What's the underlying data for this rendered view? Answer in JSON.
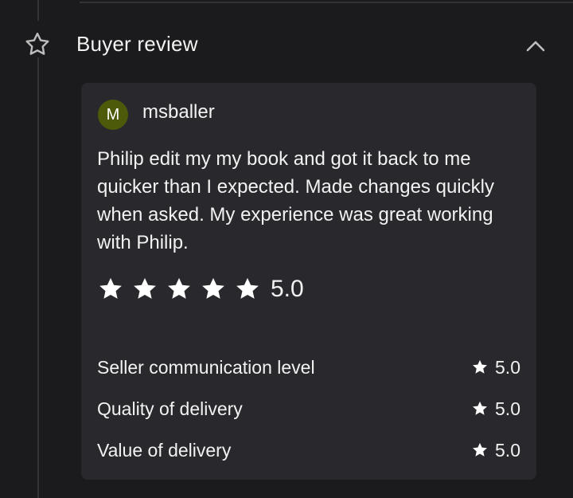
{
  "section": {
    "title": "Buyer review",
    "icon": "star-outline-icon",
    "collapse_icon": "chevron-up-icon"
  },
  "review": {
    "avatar_initial": "M",
    "avatar_color": "#4d5a09",
    "username": "msballer",
    "text": "Philip edit my my book and got it back to me quicker than I expected. Made changes quickly when asked. My experience was great working with Philip.",
    "rating": {
      "stars": 5,
      "score": "5.0"
    },
    "breakdown": [
      {
        "label": "Seller communication level",
        "score": "5.0"
      },
      {
        "label": "Quality of delivery",
        "score": "5.0"
      },
      {
        "label": "Value of delivery",
        "score": "5.0"
      }
    ]
  },
  "colors": {
    "background": "#1b1b1d",
    "card": "#29292d",
    "text": "#f2f2f2"
  }
}
